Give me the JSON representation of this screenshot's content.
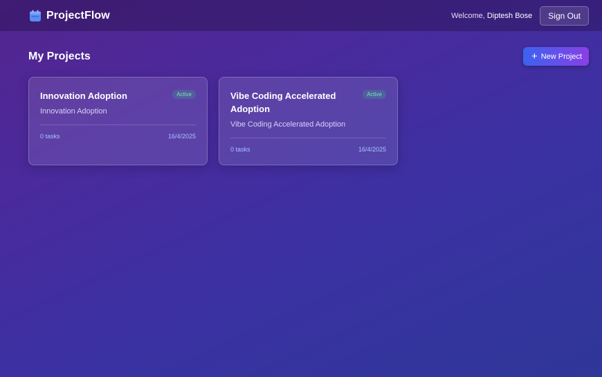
{
  "header": {
    "brand": "ProjectFlow",
    "welcome_prefix": "Welcome,",
    "user_name": "Diptesh Bose",
    "sign_out_label": "Sign Out"
  },
  "main": {
    "title": "My Projects",
    "new_project_label": "New Project",
    "projects": [
      {
        "title": "Innovation Adoption",
        "status": "Active",
        "description": "Innovation Adoption",
        "tasks": "0 tasks",
        "date": "16/4/2025"
      },
      {
        "title": "Vibe Coding Accelerated Adoption",
        "status": "Active",
        "description": "Vibe Coding Accelerated Adoption",
        "tasks": "0 tasks",
        "date": "16/4/2025"
      }
    ]
  },
  "colors": {
    "accent_start": "#3b63ee",
    "accent_end": "#8a3fe6",
    "brand_icon": "#5b8df5",
    "status_active": "#7ee2b8"
  },
  "icons": {
    "brand": "calendar-icon",
    "new_project": "plus-icon"
  }
}
